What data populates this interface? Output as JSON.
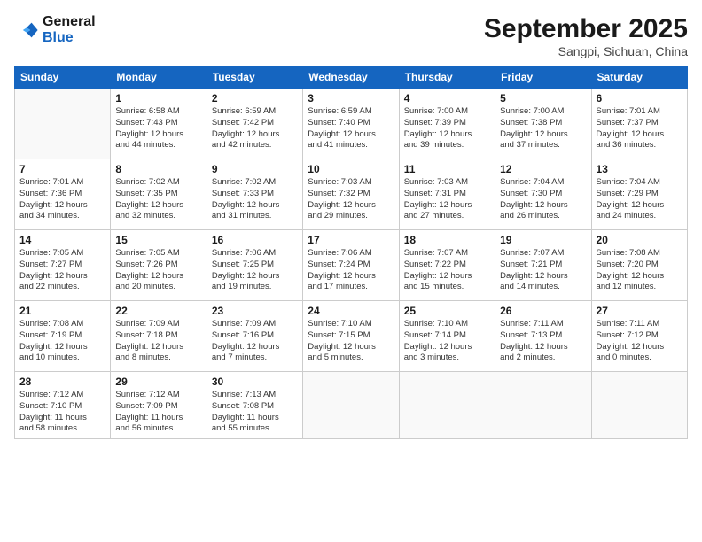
{
  "logo": {
    "line1": "General",
    "line2": "Blue"
  },
  "title": "September 2025",
  "subtitle": "Sangpi, Sichuan, China",
  "days_header": [
    "Sunday",
    "Monday",
    "Tuesday",
    "Wednesday",
    "Thursday",
    "Friday",
    "Saturday"
  ],
  "weeks": [
    [
      {
        "num": "",
        "info": ""
      },
      {
        "num": "1",
        "info": "Sunrise: 6:58 AM\nSunset: 7:43 PM\nDaylight: 12 hours\nand 44 minutes."
      },
      {
        "num": "2",
        "info": "Sunrise: 6:59 AM\nSunset: 7:42 PM\nDaylight: 12 hours\nand 42 minutes."
      },
      {
        "num": "3",
        "info": "Sunrise: 6:59 AM\nSunset: 7:40 PM\nDaylight: 12 hours\nand 41 minutes."
      },
      {
        "num": "4",
        "info": "Sunrise: 7:00 AM\nSunset: 7:39 PM\nDaylight: 12 hours\nand 39 minutes."
      },
      {
        "num": "5",
        "info": "Sunrise: 7:00 AM\nSunset: 7:38 PM\nDaylight: 12 hours\nand 37 minutes."
      },
      {
        "num": "6",
        "info": "Sunrise: 7:01 AM\nSunset: 7:37 PM\nDaylight: 12 hours\nand 36 minutes."
      }
    ],
    [
      {
        "num": "7",
        "info": "Sunrise: 7:01 AM\nSunset: 7:36 PM\nDaylight: 12 hours\nand 34 minutes."
      },
      {
        "num": "8",
        "info": "Sunrise: 7:02 AM\nSunset: 7:35 PM\nDaylight: 12 hours\nand 32 minutes."
      },
      {
        "num": "9",
        "info": "Sunrise: 7:02 AM\nSunset: 7:33 PM\nDaylight: 12 hours\nand 31 minutes."
      },
      {
        "num": "10",
        "info": "Sunrise: 7:03 AM\nSunset: 7:32 PM\nDaylight: 12 hours\nand 29 minutes."
      },
      {
        "num": "11",
        "info": "Sunrise: 7:03 AM\nSunset: 7:31 PM\nDaylight: 12 hours\nand 27 minutes."
      },
      {
        "num": "12",
        "info": "Sunrise: 7:04 AM\nSunset: 7:30 PM\nDaylight: 12 hours\nand 26 minutes."
      },
      {
        "num": "13",
        "info": "Sunrise: 7:04 AM\nSunset: 7:29 PM\nDaylight: 12 hours\nand 24 minutes."
      }
    ],
    [
      {
        "num": "14",
        "info": "Sunrise: 7:05 AM\nSunset: 7:27 PM\nDaylight: 12 hours\nand 22 minutes."
      },
      {
        "num": "15",
        "info": "Sunrise: 7:05 AM\nSunset: 7:26 PM\nDaylight: 12 hours\nand 20 minutes."
      },
      {
        "num": "16",
        "info": "Sunrise: 7:06 AM\nSunset: 7:25 PM\nDaylight: 12 hours\nand 19 minutes."
      },
      {
        "num": "17",
        "info": "Sunrise: 7:06 AM\nSunset: 7:24 PM\nDaylight: 12 hours\nand 17 minutes."
      },
      {
        "num": "18",
        "info": "Sunrise: 7:07 AM\nSunset: 7:22 PM\nDaylight: 12 hours\nand 15 minutes."
      },
      {
        "num": "19",
        "info": "Sunrise: 7:07 AM\nSunset: 7:21 PM\nDaylight: 12 hours\nand 14 minutes."
      },
      {
        "num": "20",
        "info": "Sunrise: 7:08 AM\nSunset: 7:20 PM\nDaylight: 12 hours\nand 12 minutes."
      }
    ],
    [
      {
        "num": "21",
        "info": "Sunrise: 7:08 AM\nSunset: 7:19 PM\nDaylight: 12 hours\nand 10 minutes."
      },
      {
        "num": "22",
        "info": "Sunrise: 7:09 AM\nSunset: 7:18 PM\nDaylight: 12 hours\nand 8 minutes."
      },
      {
        "num": "23",
        "info": "Sunrise: 7:09 AM\nSunset: 7:16 PM\nDaylight: 12 hours\nand 7 minutes."
      },
      {
        "num": "24",
        "info": "Sunrise: 7:10 AM\nSunset: 7:15 PM\nDaylight: 12 hours\nand 5 minutes."
      },
      {
        "num": "25",
        "info": "Sunrise: 7:10 AM\nSunset: 7:14 PM\nDaylight: 12 hours\nand 3 minutes."
      },
      {
        "num": "26",
        "info": "Sunrise: 7:11 AM\nSunset: 7:13 PM\nDaylight: 12 hours\nand 2 minutes."
      },
      {
        "num": "27",
        "info": "Sunrise: 7:11 AM\nSunset: 7:12 PM\nDaylight: 12 hours\nand 0 minutes."
      }
    ],
    [
      {
        "num": "28",
        "info": "Sunrise: 7:12 AM\nSunset: 7:10 PM\nDaylight: 11 hours\nand 58 minutes."
      },
      {
        "num": "29",
        "info": "Sunrise: 7:12 AM\nSunset: 7:09 PM\nDaylight: 11 hours\nand 56 minutes."
      },
      {
        "num": "30",
        "info": "Sunrise: 7:13 AM\nSunset: 7:08 PM\nDaylight: 11 hours\nand 55 minutes."
      },
      {
        "num": "",
        "info": ""
      },
      {
        "num": "",
        "info": ""
      },
      {
        "num": "",
        "info": ""
      },
      {
        "num": "",
        "info": ""
      }
    ]
  ]
}
